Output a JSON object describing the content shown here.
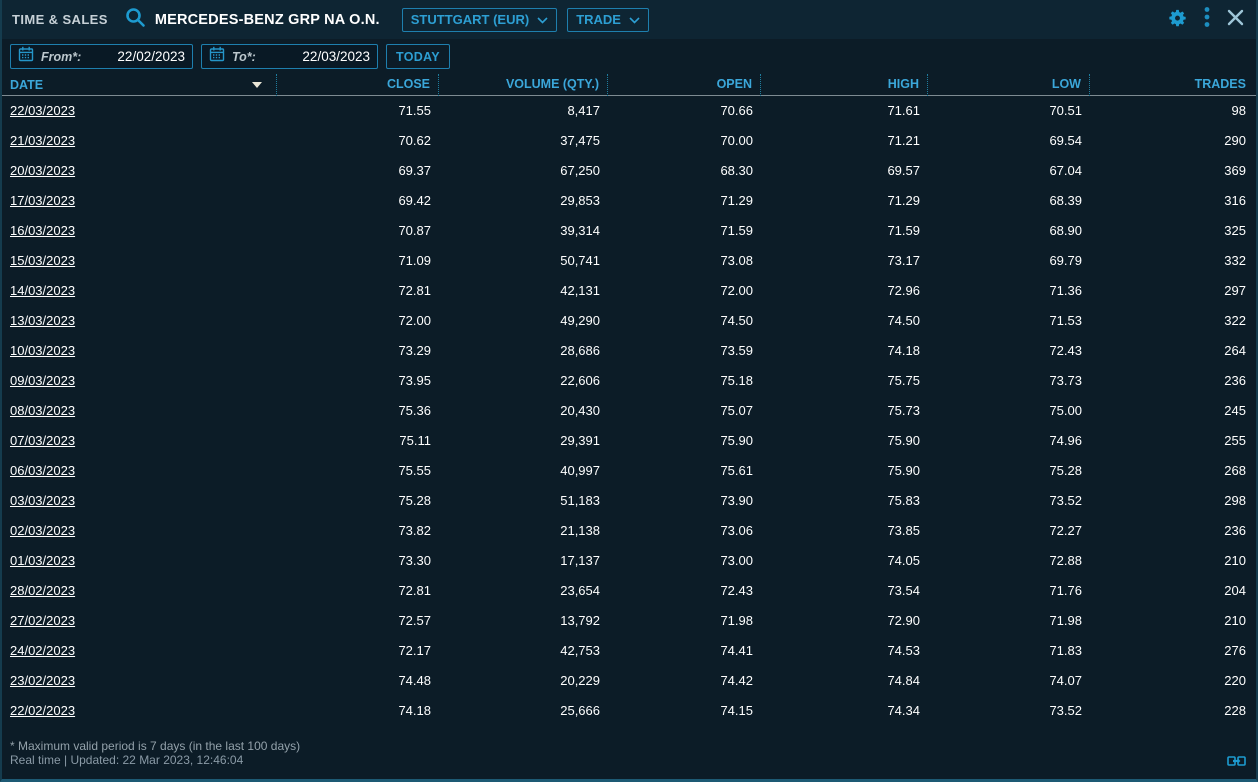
{
  "window": {
    "title": "TIME & SALES",
    "instrument": "MERCEDES-BENZ GRP NA O.N."
  },
  "toolbar": {
    "venue_dropdown": "STUTTGART (EUR)",
    "type_dropdown": "TRADE"
  },
  "filters": {
    "from_label": "From*:",
    "from_value": "22/02/2023",
    "to_label": "To*:",
    "to_value": "22/03/2023",
    "today_label": "TODAY"
  },
  "table": {
    "columns": [
      "DATE",
      "CLOSE",
      "VOLUME (QTY.)",
      "OPEN",
      "HIGH",
      "LOW",
      "TRADES"
    ],
    "rows": [
      [
        "22/03/2023",
        "71.55",
        "8,417",
        "70.66",
        "71.61",
        "70.51",
        "98"
      ],
      [
        "21/03/2023",
        "70.62",
        "37,475",
        "70.00",
        "71.21",
        "69.54",
        "290"
      ],
      [
        "20/03/2023",
        "69.37",
        "67,250",
        "68.30",
        "69.57",
        "67.04",
        "369"
      ],
      [
        "17/03/2023",
        "69.42",
        "29,853",
        "71.29",
        "71.29",
        "68.39",
        "316"
      ],
      [
        "16/03/2023",
        "70.87",
        "39,314",
        "71.59",
        "71.59",
        "68.90",
        "325"
      ],
      [
        "15/03/2023",
        "71.09",
        "50,741",
        "73.08",
        "73.17",
        "69.79",
        "332"
      ],
      [
        "14/03/2023",
        "72.81",
        "42,131",
        "72.00",
        "72.96",
        "71.36",
        "297"
      ],
      [
        "13/03/2023",
        "72.00",
        "49,290",
        "74.50",
        "74.50",
        "71.53",
        "322"
      ],
      [
        "10/03/2023",
        "73.29",
        "28,686",
        "73.59",
        "74.18",
        "72.43",
        "264"
      ],
      [
        "09/03/2023",
        "73.95",
        "22,606",
        "75.18",
        "75.75",
        "73.73",
        "236"
      ],
      [
        "08/03/2023",
        "75.36",
        "20,430",
        "75.07",
        "75.73",
        "75.00",
        "245"
      ],
      [
        "07/03/2023",
        "75.11",
        "29,391",
        "75.90",
        "75.90",
        "74.96",
        "255"
      ],
      [
        "06/03/2023",
        "75.55",
        "40,997",
        "75.61",
        "75.90",
        "75.28",
        "268"
      ],
      [
        "03/03/2023",
        "75.28",
        "51,183",
        "73.90",
        "75.83",
        "73.52",
        "298"
      ],
      [
        "02/03/2023",
        "73.82",
        "21,138",
        "73.06",
        "73.85",
        "72.27",
        "236"
      ],
      [
        "01/03/2023",
        "73.30",
        "17,137",
        "73.00",
        "74.05",
        "72.88",
        "210"
      ],
      [
        "28/02/2023",
        "72.81",
        "23,654",
        "72.43",
        "73.54",
        "71.76",
        "204"
      ],
      [
        "27/02/2023",
        "72.57",
        "13,792",
        "71.98",
        "72.90",
        "71.98",
        "210"
      ],
      [
        "24/02/2023",
        "72.17",
        "42,753",
        "74.41",
        "74.53",
        "71.83",
        "276"
      ],
      [
        "23/02/2023",
        "74.48",
        "20,229",
        "74.42",
        "74.84",
        "74.07",
        "220"
      ],
      [
        "22/02/2023",
        "74.18",
        "25,666",
        "74.15",
        "74.34",
        "73.52",
        "228"
      ]
    ]
  },
  "footer": {
    "note": "* Maximum valid period is 7 days (in the last 100 days)",
    "status": "Real time | Updated: 22 Mar 2023, 12:46:04"
  },
  "colors": {
    "accent_cyan": "#1d9bd0",
    "header_text": "#3ba7da",
    "background": "#0c1c27",
    "titlebar_background": "#0e2533",
    "border_cyan": "#1e7fae",
    "footer_text": "#93a1aa"
  }
}
